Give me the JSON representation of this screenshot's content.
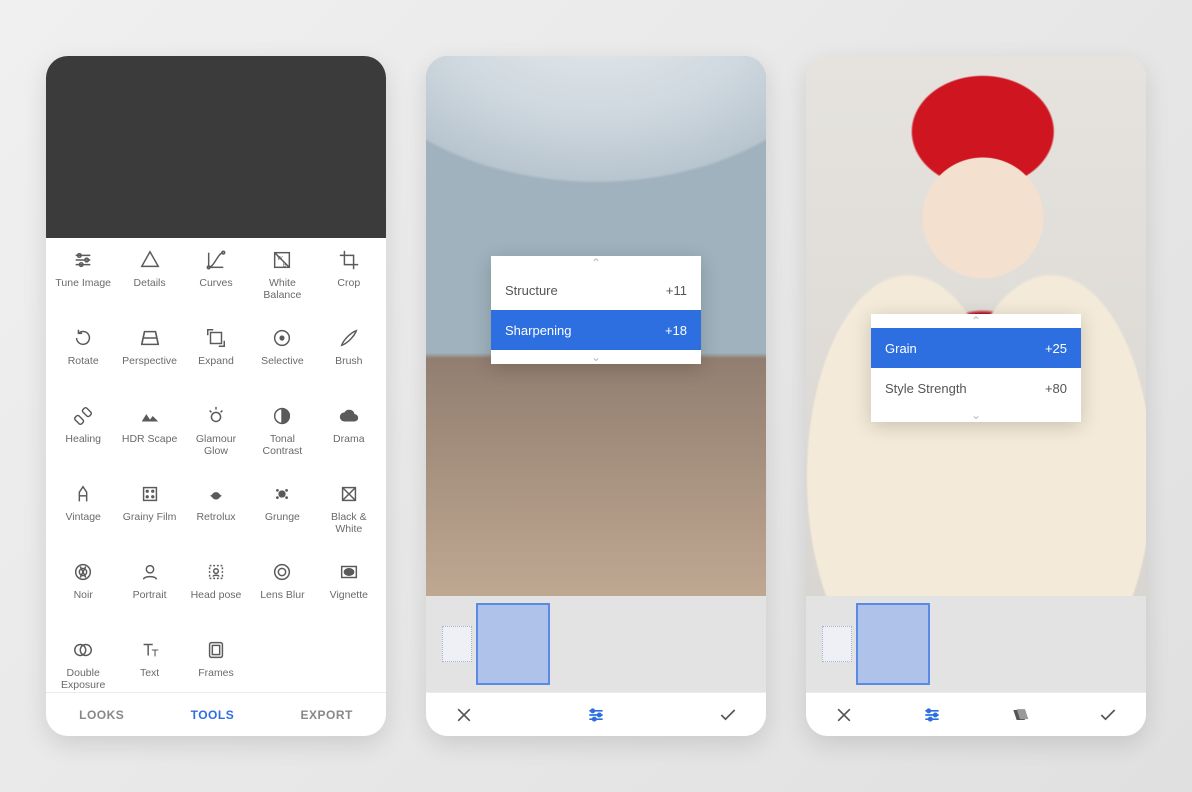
{
  "colors": {
    "accent": "#2d6fe0"
  },
  "phone1": {
    "tools": [
      {
        "id": "tune-image",
        "label": "Tune Image"
      },
      {
        "id": "details",
        "label": "Details"
      },
      {
        "id": "curves",
        "label": "Curves"
      },
      {
        "id": "white-balance",
        "label": "White Balance"
      },
      {
        "id": "crop",
        "label": "Crop"
      },
      {
        "id": "rotate",
        "label": "Rotate"
      },
      {
        "id": "perspective",
        "label": "Perspective"
      },
      {
        "id": "expand",
        "label": "Expand"
      },
      {
        "id": "selective",
        "label": "Selective"
      },
      {
        "id": "brush",
        "label": "Brush"
      },
      {
        "id": "healing",
        "label": "Healing"
      },
      {
        "id": "hdr-scape",
        "label": "HDR Scape"
      },
      {
        "id": "glamour-glow",
        "label": "Glamour Glow"
      },
      {
        "id": "tonal-contrast",
        "label": "Tonal Contrast"
      },
      {
        "id": "drama",
        "label": "Drama"
      },
      {
        "id": "vintage",
        "label": "Vintage"
      },
      {
        "id": "grainy-film",
        "label": "Grainy Film"
      },
      {
        "id": "retrolux",
        "label": "Retrolux"
      },
      {
        "id": "grunge",
        "label": "Grunge"
      },
      {
        "id": "black-white",
        "label": "Black & White"
      },
      {
        "id": "noir",
        "label": "Noir"
      },
      {
        "id": "portrait",
        "label": "Portrait"
      },
      {
        "id": "head-pose",
        "label": "Head pose"
      },
      {
        "id": "lens-blur",
        "label": "Lens Blur"
      },
      {
        "id": "vignette",
        "label": "Vignette"
      },
      {
        "id": "double-exposure",
        "label": "Double Exposure"
      },
      {
        "id": "text",
        "label": "Text"
      },
      {
        "id": "frames",
        "label": "Frames"
      }
    ],
    "tabs": {
      "looks": "LOOKS",
      "tools": "TOOLS",
      "export": "EXPORT",
      "active": "tools"
    }
  },
  "phone2": {
    "params": [
      {
        "name": "Structure",
        "value": "+11",
        "selected": false
      },
      {
        "name": "Sharpening",
        "value": "+18",
        "selected": true
      }
    ]
  },
  "phone3": {
    "params": [
      {
        "name": "Grain",
        "value": "+25",
        "selected": true
      },
      {
        "name": "Style Strength",
        "value": "+80",
        "selected": false
      }
    ]
  }
}
